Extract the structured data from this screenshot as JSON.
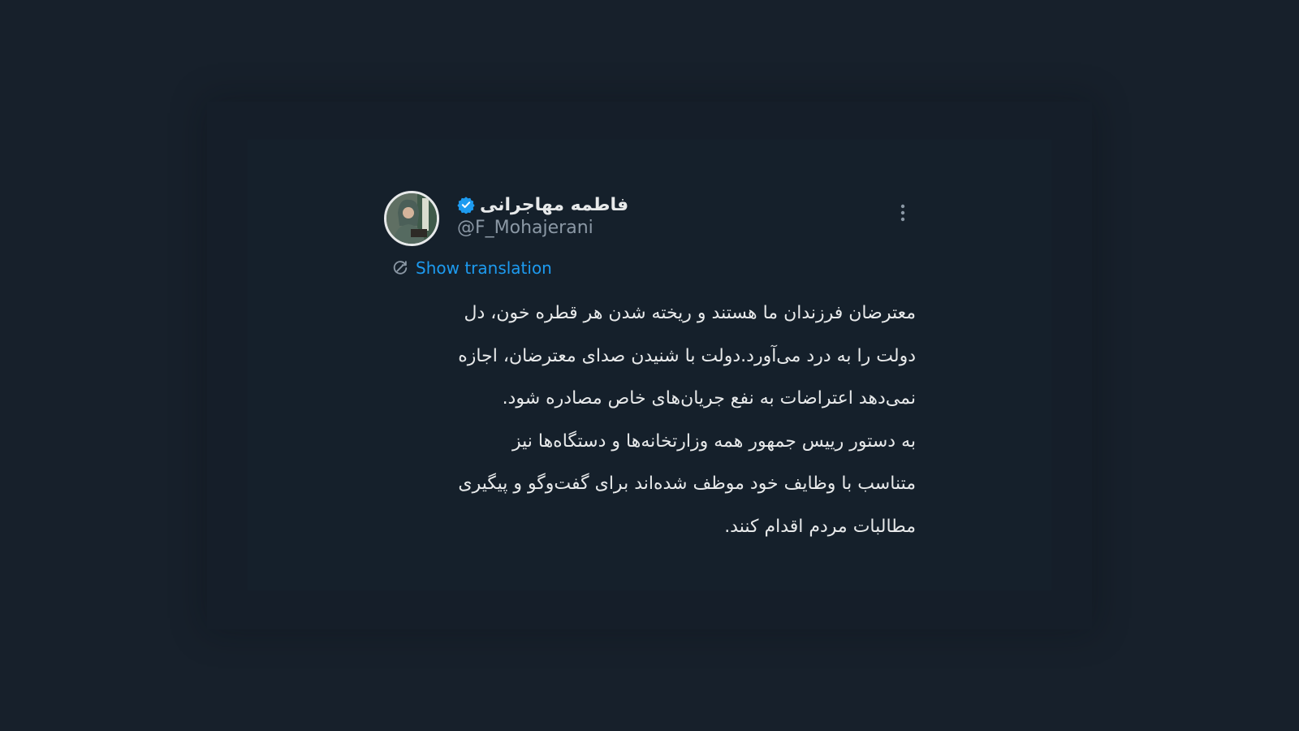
{
  "tweet": {
    "author": {
      "display_name": "فاطمه مهاجرانی",
      "handle": "@F_Mohajerani",
      "verified": true,
      "avatar_icon": "profile-photo"
    },
    "more_icon": "vertical-ellipsis-icon",
    "translation": {
      "icon": "translate-icon",
      "label": "Show translation"
    },
    "body_lines": [
      "معترضان فرزندان ما هستند و ریخته شدن هر قطره خون، دل",
      "دولت را به درد می‌آورد.دولت با شنیدن صدای معترضان، اجازه",
      "نمی‌دهد اعتراضات به نفع جریان‌های خاص مصادره شود.",
      "به دستور رییس جمهور همه وزارتخانه‌ها و دستگاه‌ها نیز",
      "متناسب با وظایف خود موظف شده‌اند برای گفت‌وگو و پیگیری",
      "مطالبات مردم اقدام کنند."
    ]
  },
  "colors": {
    "background": "#17202b",
    "card": "#15202b",
    "text": "#e7e9ea",
    "muted": "#8b98a5",
    "accent": "#1d9bf0"
  }
}
